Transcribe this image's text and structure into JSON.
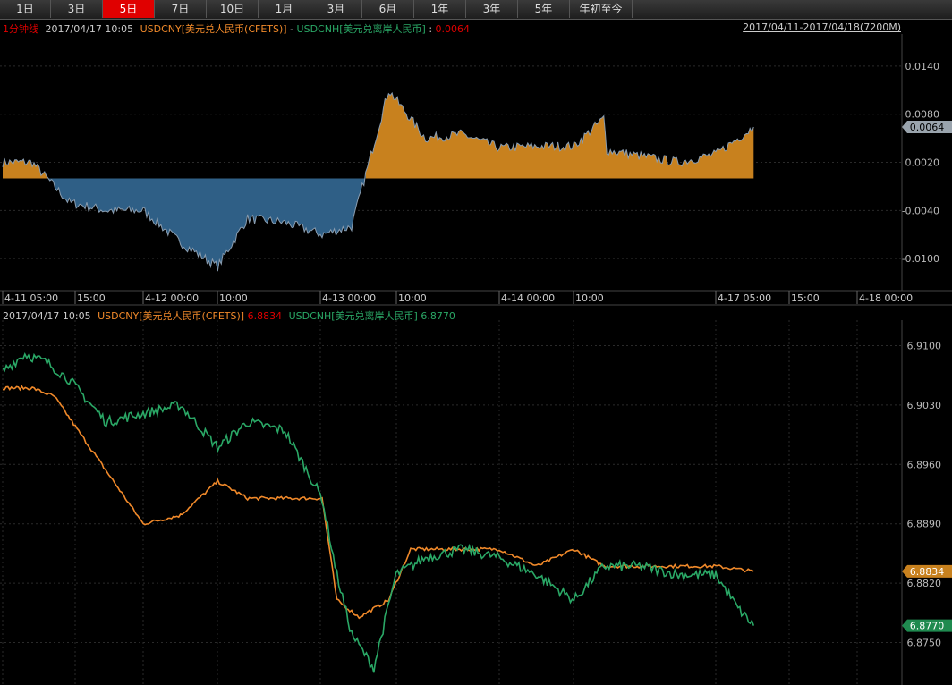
{
  "tabs": [
    "1日",
    "3日",
    "5日",
    "7日",
    "10日",
    "1月",
    "3月",
    "6月",
    "1年",
    "3年",
    "5年",
    "年初至今"
  ],
  "active_tab": 2,
  "top_header": {
    "interval": "1分钟线",
    "datetime": "2017/04/17 10:05",
    "series_a": "USDCNY[美元兑人民币(CFETS)]",
    "sep": " - ",
    "series_b": "USDCNH[美元兑离岸人民币]",
    "colon": " : ",
    "value": "0.0064",
    "range_link": "2017/04/11-2017/04/18(7200M)"
  },
  "bottom_header": {
    "datetime": "2017/04/17 10:05",
    "series_a": "USDCNY[美元兑人民币(CFETS)]",
    "value_a": "6.8834",
    "series_b": "USDCNH[美元兑离岸人民币]",
    "value_b": "6.8770"
  },
  "colors": {
    "positive": "#c8811e",
    "negative": "#2f5f86",
    "spread_line": "#8a9db0",
    "usdcny": "#f0892a",
    "usdcnh": "#2aa866",
    "accent_red": "#e00000",
    "grid": "#2a2a2a"
  },
  "chart_data": [
    {
      "type": "area",
      "title": "USDCNY - USDCNH spread",
      "x": [
        "4-11 05:00",
        "4-11 09:00",
        "4-11 14:00",
        "4-11 19:00",
        "4-12 00:00",
        "4-12 05:00",
        "4-12 10:00",
        "4-12 14:00",
        "4-12 19:00",
        "4-13 00:00",
        "4-13 04:00",
        "4-13 09:00",
        "4-13 14:00",
        "4-13 19:00",
        "4-14 00:00",
        "4-14 05:00",
        "4-14 10:00",
        "4-14 14:00",
        "4-15 00:00",
        "4-17 00:00",
        "4-17 05:00",
        "4-17 10:05"
      ],
      "values": [
        0.002,
        0.002,
        -0.003,
        -0.004,
        -0.004,
        -0.008,
        -0.011,
        -0.005,
        -0.0055,
        -0.007,
        -0.006,
        0.011,
        0.005,
        0.0055,
        0.0038,
        0.004,
        0.004,
        0.0075,
        0.0035,
        0.002,
        0.003,
        0.0064
      ],
      "baseline": 0.0,
      "y_ticks": [
        "0.0140",
        "0.0080",
        "0.0020",
        "-0.0040",
        "-0.0100"
      ],
      "ylim": [
        -0.014,
        0.018
      ],
      "x_ticks": [
        "4-11 05:00",
        "15:00",
        "4-12 00:00",
        "10:00",
        "4-13 00:00",
        "10:00",
        "4-14 00:00",
        "10:00",
        "4-17 05:00",
        "15:00",
        "4-18 00:00"
      ],
      "last_value_label": "0.0064"
    },
    {
      "type": "line",
      "y_ticks": [
        "6.9100",
        "6.9030",
        "6.8960",
        "6.8890",
        "6.8820",
        "6.8750"
      ],
      "ylim": [
        6.87,
        6.913
      ],
      "series": [
        {
          "name": "USDCNY[美元兑人民币(CFETS)]",
          "x": [
            "4-11 05:00",
            "4-11 09:00",
            "4-11 12:00",
            "4-11 16:00",
            "4-12 00:00",
            "4-12 05:00",
            "4-12 10:00",
            "4-12 14:00",
            "4-12 19:00",
            "4-13 00:00",
            "4-13 02:00",
            "4-13 05:00",
            "4-13 09:00",
            "4-13 12:00",
            "4-13 16:00",
            "4-13 21:00",
            "4-14 00:00",
            "4-14 05:00",
            "4-14 10:00",
            "4-14 14:00",
            "4-14 18:00",
            "4-17 00:00",
            "4-17 05:00",
            "4-17 10:05"
          ],
          "values": [
            6.905,
            6.905,
            6.904,
            6.899,
            6.889,
            6.89,
            6.894,
            6.892,
            6.892,
            6.892,
            6.88,
            6.878,
            6.88,
            6.886,
            6.886,
            6.886,
            6.886,
            6.884,
            6.886,
            6.884,
            6.884,
            6.884,
            6.884,
            6.8834
          ]
        },
        {
          "name": "USDCNH[美元兑离岸人民币]",
          "x": [
            "4-11 05:00",
            "4-11 08:00",
            "4-11 11:00",
            "4-11 14:00",
            "4-11 19:00",
            "4-12 00:00",
            "4-12 05:00",
            "4-12 10:00",
            "4-12 14:00",
            "4-12 19:00",
            "4-13 00:00",
            "4-13 02:00",
            "4-13 04:00",
            "4-13 07:00",
            "4-13 10:00",
            "4-13 14:00",
            "4-13 19:00",
            "4-14 00:00",
            "4-14 05:00",
            "4-14 10:00",
            "4-14 14:00",
            "4-14 19:00",
            "4-17 00:00",
            "4-17 05:00",
            "4-17 08:00",
            "4-17 10:05"
          ],
          "values": [
            6.907,
            6.909,
            6.908,
            6.906,
            6.901,
            6.902,
            6.903,
            6.898,
            6.901,
            6.9,
            6.892,
            6.883,
            6.876,
            6.872,
            6.883,
            6.885,
            6.886,
            6.885,
            6.883,
            6.88,
            6.884,
            6.884,
            6.883,
            6.883,
            6.879,
            6.877
          ]
        }
      ],
      "x_ticks": [],
      "last_value_labels": [
        "6.8834",
        "6.8770"
      ]
    }
  ]
}
